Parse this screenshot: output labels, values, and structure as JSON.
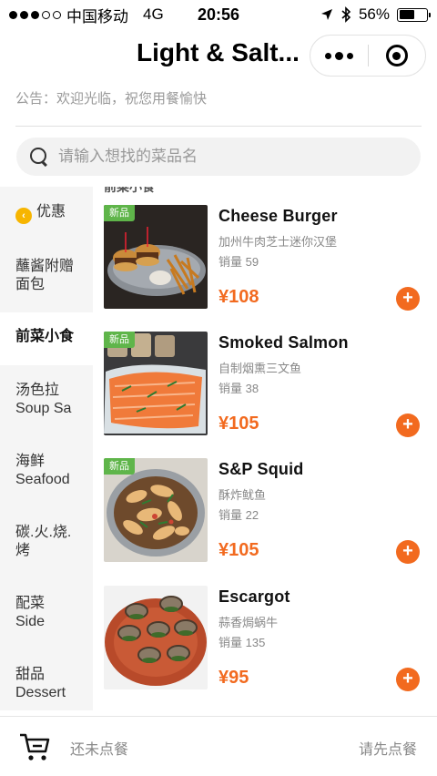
{
  "status_bar": {
    "carrier": "中国移动",
    "network": "4G",
    "time": "20:56",
    "battery": "56%",
    "battery_level": 0.56
  },
  "nav": {
    "title": "Light & Salt..."
  },
  "notice": "公告：欢迎光临，祝您用餐愉快",
  "search": {
    "placeholder": "请输入想找的菜品名"
  },
  "categories": [
    {
      "label": "优惠",
      "active": false
    },
    {
      "label": "蘸酱附赠",
      "label2": "面包",
      "active": false
    },
    {
      "label": "前菜小食",
      "active": true
    },
    {
      "label": "汤色拉",
      "label2": "Soup Sa",
      "active": false
    },
    {
      "label": "海鲜",
      "label2": "Seafood",
      "active": false
    },
    {
      "label": "碳.火.烧.",
      "label2": "烤",
      "active": false
    },
    {
      "label": "配菜",
      "label2": "Side",
      "active": false
    },
    {
      "label": "甜品",
      "label2": "Dessert",
      "active": false
    }
  ],
  "section_title": "前菜小食",
  "items": [
    {
      "badge": "新品",
      "name": "Cheese Burger",
      "desc": "加州牛肉芝士迷你汉堡",
      "sales": "销量 59",
      "price": "¥108"
    },
    {
      "badge": "新品",
      "name": "Smoked Salmon",
      "desc": "自制烟熏三文鱼",
      "sales": "销量 38",
      "price": "¥105"
    },
    {
      "badge": "新品",
      "name": "S&P Squid",
      "desc": "酥炸鱿鱼",
      "sales": "销量 22",
      "price": "¥105"
    },
    {
      "badge": "",
      "name": "Escargot",
      "desc": "蒜香焗蜗牛",
      "sales": "销量 135",
      "price": "¥95"
    }
  ],
  "add_label": "+",
  "bottom": {
    "cart_status": "还未点餐",
    "checkout": "请先点餐"
  },
  "icons": {
    "cart": "cart-icon",
    "search": "search-icon",
    "more": "more-icon",
    "close": "close-miniprogram-icon",
    "location": "location-arrow-icon",
    "bluetooth": "bluetooth-icon",
    "promo": "promo-icon"
  },
  "colors": {
    "accent": "#f26a1f",
    "badge": "#5fb54a",
    "promo": "#f7b500"
  }
}
